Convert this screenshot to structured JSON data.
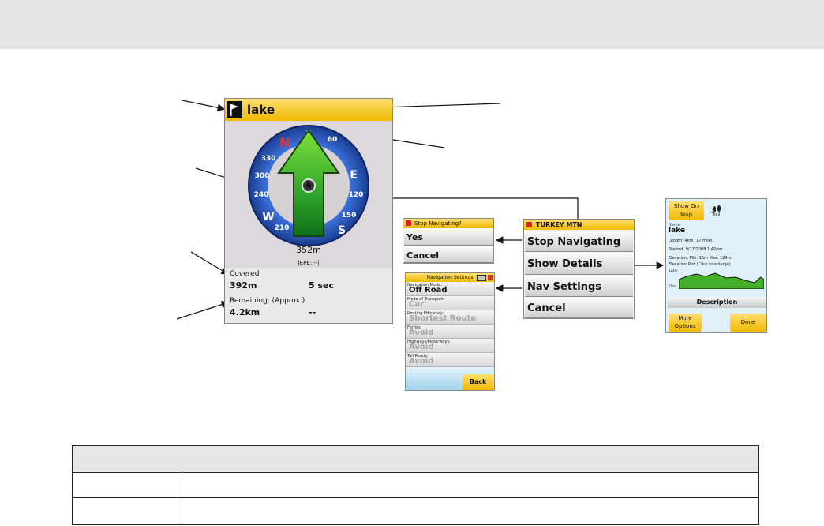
{
  "main_screen": {
    "title": "lake",
    "distance": "352m",
    "epe": "|EPE: --|",
    "covered_label": "Covered",
    "covered_distance": "392m",
    "covered_time": "5 sec",
    "remaining_label": "Remaining: (Approx.)",
    "remaining_distance": "4.2km",
    "remaining_time": "--",
    "compass_letters": [
      "N",
      "E",
      "S",
      "W"
    ],
    "compass_numbers": [
      "3",
      "60",
      "120",
      "150",
      "210",
      "240",
      "300",
      "330"
    ]
  },
  "stop_dialog": {
    "title": "Stop Navigating?",
    "yes": "Yes",
    "cancel": "Cancel"
  },
  "menu": {
    "title": "TURKEY MTN",
    "items": [
      "Stop Navigating",
      "Show Details",
      "Nav Settings",
      "Cancel"
    ]
  },
  "nav_settings": {
    "title": "Navigation Settings",
    "fields": [
      {
        "label": "Navigation Mode:",
        "value": "Off Road"
      },
      {
        "label": "Mode of Transport:",
        "value": "Car"
      },
      {
        "label": "Routing Efficiency:",
        "value": "Shortest Route"
      },
      {
        "label": "Ferries:",
        "value": "Avoid"
      },
      {
        "label": "Highways/Motorways:",
        "value": "Avoid"
      },
      {
        "label": "Toll Roads:",
        "value": "Avoid"
      }
    ],
    "back": "Back"
  },
  "details": {
    "show_on_map": "Show On Map",
    "trail_label": "Trail",
    "name_label": "Name",
    "name_value": "lake",
    "length": "Length: 4km (17 mile)",
    "started": "Started: 9/17/2008 1:42pm",
    "elevation": "Elevation: Min: 15m  Max: 124m",
    "elevation_plot": "Elevation Plot (Click to enlarge)",
    "plot_max": "124m",
    "plot_min": "15m",
    "description": "Description",
    "more_options": "More Options",
    "done": "Done"
  },
  "table": {
    "header": "",
    "rows": [
      [
        "",
        ""
      ],
      [
        "",
        ""
      ]
    ]
  }
}
